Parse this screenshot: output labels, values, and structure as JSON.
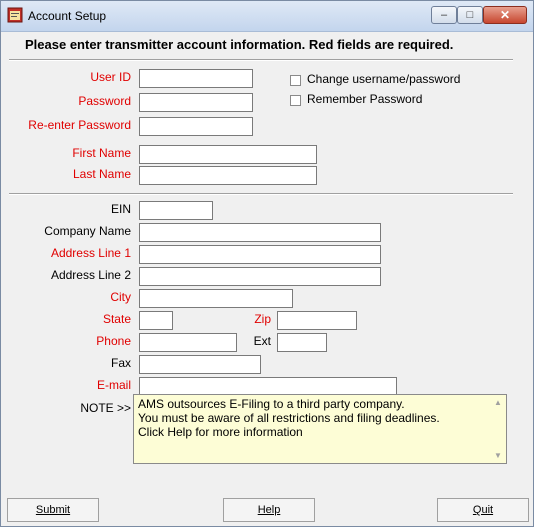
{
  "window": {
    "title": "Account Setup",
    "minimize_glyph": "–",
    "maximize_glyph": "□",
    "close_glyph": "✕"
  },
  "heading": "Please enter transmitter account information.  Red fields are required.",
  "account": {
    "user_id_label": "User ID",
    "password_label": "Password",
    "reenter_label": "Re-enter Password",
    "first_name_label": "First Name",
    "last_name_label": "Last Name",
    "user_id_value": "",
    "password_value": "",
    "reenter_value": "",
    "first_name_value": "",
    "last_name_value": ""
  },
  "options": {
    "change_username": {
      "label": "Change username/password",
      "checked": false
    },
    "remember_password": {
      "label": "Remember Password",
      "checked": false
    }
  },
  "company": {
    "ein_label": "EIN",
    "company_name_label": "Company Name",
    "address1_label": "Address Line 1",
    "address2_label": "Address Line 2",
    "city_label": "City",
    "state_label": "State",
    "zip_label": "Zip",
    "phone_label": "Phone",
    "ext_label": "Ext",
    "fax_label": "Fax",
    "email_label": "E-mail"
  },
  "note": {
    "label": "NOTE >>",
    "text": "AMS outsources E-Filing to a third party company.\nYou must be aware of all restrictions and filing deadlines.\nClick Help for more information"
  },
  "buttons": {
    "submit": "Submit",
    "help": "Help",
    "quit": "Quit"
  },
  "colors": {
    "required": "#e00000",
    "note_bg": "#fdfdd6",
    "window_bg": "#f0f0f0"
  }
}
